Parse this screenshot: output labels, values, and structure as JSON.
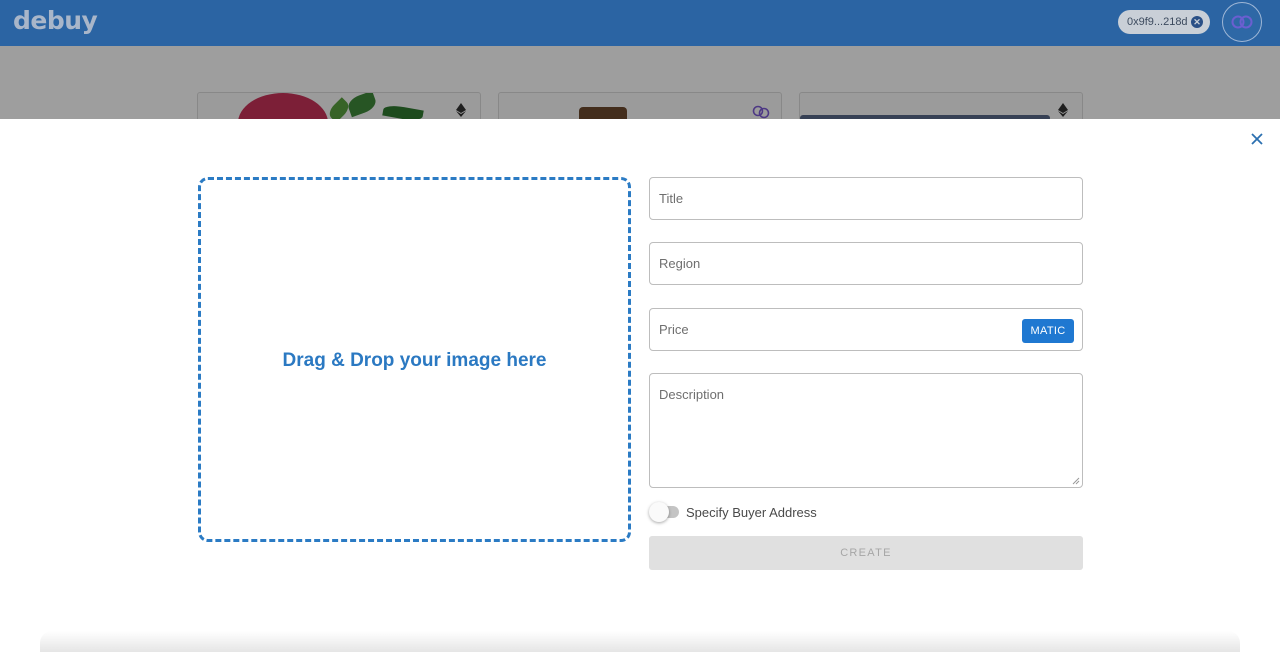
{
  "header": {
    "logo": "debuy",
    "wallet_address": "0x9f9...218d"
  },
  "upload": {
    "label": "Drag & Drop your image here"
  },
  "form": {
    "title_placeholder": "Title",
    "region_placeholder": "Region",
    "price_placeholder": "Price",
    "currency": "MATIC",
    "description_placeholder": "Description",
    "toggle_label": "Specify Buyer Address",
    "toggle_on": false,
    "create_label": "CREATE"
  },
  "colors": {
    "header_bg": "#2b64a3",
    "accent": "#2b7bc4",
    "badge_bg": "#1f78d1",
    "disabled_bg": "#e0e0e0"
  },
  "icons": {
    "close": "close-icon",
    "wallet_disconnect": "close-circle-icon",
    "network": "polygon-icon",
    "eth": "ethereum-icon"
  }
}
